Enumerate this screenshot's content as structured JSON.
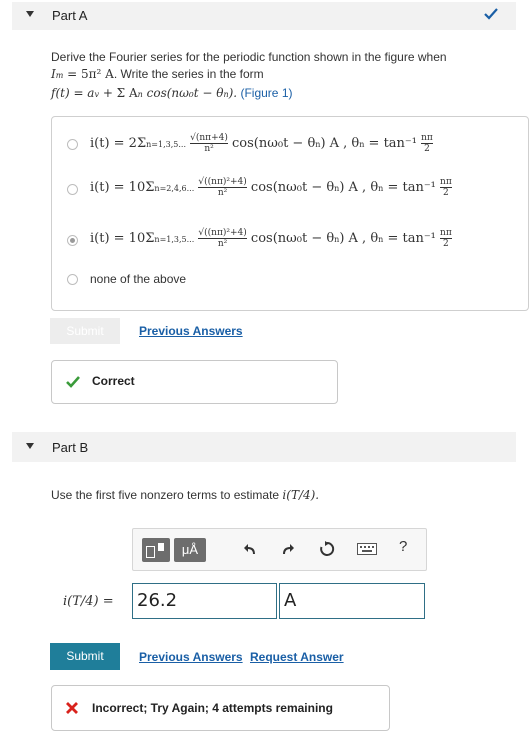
{
  "partA": {
    "label": "Part A",
    "question_line1": "Derive the Fourier series for the periodic function shown in the figure when",
    "question_line2_math": "I",
    "question_line2_sub": "m",
    "question_line2_rest": " = 5π² A",
    "question_line2_text": ". Write the series in the form",
    "question_line3_math": "f(t) = a",
    "question_line3_rest": " + Σ A",
    "question_line3_tail": " cos(nω₀t − θ",
    "question_line3_end": ").",
    "figure_link": "(Figure 1)",
    "options": [
      {
        "lead": "i(t) = 2Σ",
        "range": "n=1,3,5...",
        "frac_num": "√(nπ+4)",
        "frac_den": "n²",
        "body": "cos(nω₀t − θ",
        "tail": ") A , θ",
        "tan": " = tan⁻¹",
        "tan_frac_num": "nπ",
        "tan_frac_den": "2",
        "selected": false
      },
      {
        "lead": "i(t) = 10Σ",
        "range": "n=2,4,6...",
        "frac_num": "√((nπ)²+4)",
        "frac_den": "n²",
        "body": "cos(nω₀t − θ",
        "tail": ") A , θ",
        "tan": " = tan⁻¹",
        "tan_frac_num": "nπ",
        "tan_frac_den": "2",
        "selected": false
      },
      {
        "lead": "i(t) = 10Σ",
        "range": "n=1,3,5...",
        "frac_num": "√((nπ)²+4)",
        "frac_den": "n²",
        "body": "cos(nω₀t − θ",
        "tail": ") A , θ",
        "tan": " = tan⁻¹",
        "tan_frac_num": "nπ",
        "tan_frac_den": "2",
        "selected": true
      }
    ],
    "none_option": "none of the above",
    "submit_label": "Submit",
    "previous_answers": "Previous Answers",
    "feedback": "Correct"
  },
  "partB": {
    "label": "Part B",
    "question": "Use the first five nonzero terms to estimate ",
    "question_math": "i(T/4).",
    "answer_label": "i(T/4) =",
    "answer_value": "26.2",
    "unit_value": "A",
    "toolbar": {
      "units_button": "μÅ",
      "help": "?"
    },
    "submit_label": "Submit",
    "previous_answers": "Previous Answers",
    "request_answer": "Request Answer",
    "feedback": "Incorrect; Try Again; 4 attempts remaining"
  },
  "colors": {
    "accent": "#1f7e9a",
    "link": "#1a5fa6",
    "correct": "#3a9b3a",
    "incorrect": "#d9221c"
  }
}
